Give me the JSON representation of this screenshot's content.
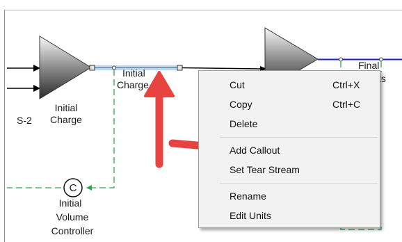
{
  "diagram": {
    "s2_label": "S-2",
    "initial_charge_block_line1": "Initial",
    "initial_charge_block_line2": "Charge",
    "initial_charge_stream_line1": "Initial",
    "initial_charge_stream_line2": "Charge",
    "final_line1": "Final",
    "final_line2_visible": "ts",
    "controller_symbol": "C",
    "controller_label_line1": "Initial",
    "controller_label_line2": "Volume",
    "controller_label_line3": "Controller"
  },
  "context_menu": {
    "items": [
      {
        "label": "Cut",
        "shortcut": "Ctrl+X"
      },
      {
        "label": "Copy",
        "shortcut": "Ctrl+C"
      },
      {
        "label": "Delete",
        "shortcut": ""
      },
      {
        "label": "Add Callout",
        "shortcut": ""
      },
      {
        "label": "Set Tear Stream",
        "shortcut": ""
      },
      {
        "label": "Rename",
        "shortcut": ""
      },
      {
        "label": "Edit Units",
        "shortcut": ""
      }
    ]
  },
  "colors": {
    "annotation_arrow": "#e8433f",
    "selected_stream": "#bcd6f0",
    "product_stream": "#1f1fd0",
    "control_signal": "#2fa84a"
  },
  "icons": {
    "process_block": "mixer-triangle-icon",
    "controller": "controller-circle-icon",
    "annotation": "red-arrow-icon"
  }
}
